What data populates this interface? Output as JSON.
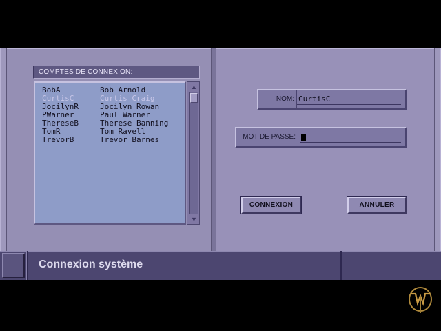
{
  "accounts": {
    "header": "COMPTES DE CONNEXION:",
    "rows": [
      {
        "user": "BobA",
        "name": "Bob Arnold"
      },
      {
        "user": "CurtisC",
        "name": "Curtis Craig"
      },
      {
        "user": "JocilynR",
        "name": "Jocilyn Rowan"
      },
      {
        "user": "PWarner",
        "name": "Paul Warner"
      },
      {
        "user": "ThereseB",
        "name": "Therese Banning"
      },
      {
        "user": "TomR",
        "name": "Tom Ravell"
      },
      {
        "user": "TrevorB",
        "name": "Trevor Barnes"
      }
    ],
    "selected_user": "CurtisC"
  },
  "form": {
    "nom_label": "NOM:",
    "nom_value": "CurtisC",
    "password_label": "MOT DE PASSE:",
    "password_value": ""
  },
  "buttons": {
    "connect": "CONNEXION",
    "cancel": "ANNULER"
  },
  "statusbar": {
    "title": "Connexion système"
  },
  "icons": {
    "scroll_up": "scroll-up-arrow-icon",
    "scroll_down": "scroll-down-arrow-icon",
    "logo": "w-logo-icon"
  },
  "colors": {
    "panel": "#958fb4",
    "list_bg": "#8e9cc8",
    "bar": "#4c4670"
  }
}
